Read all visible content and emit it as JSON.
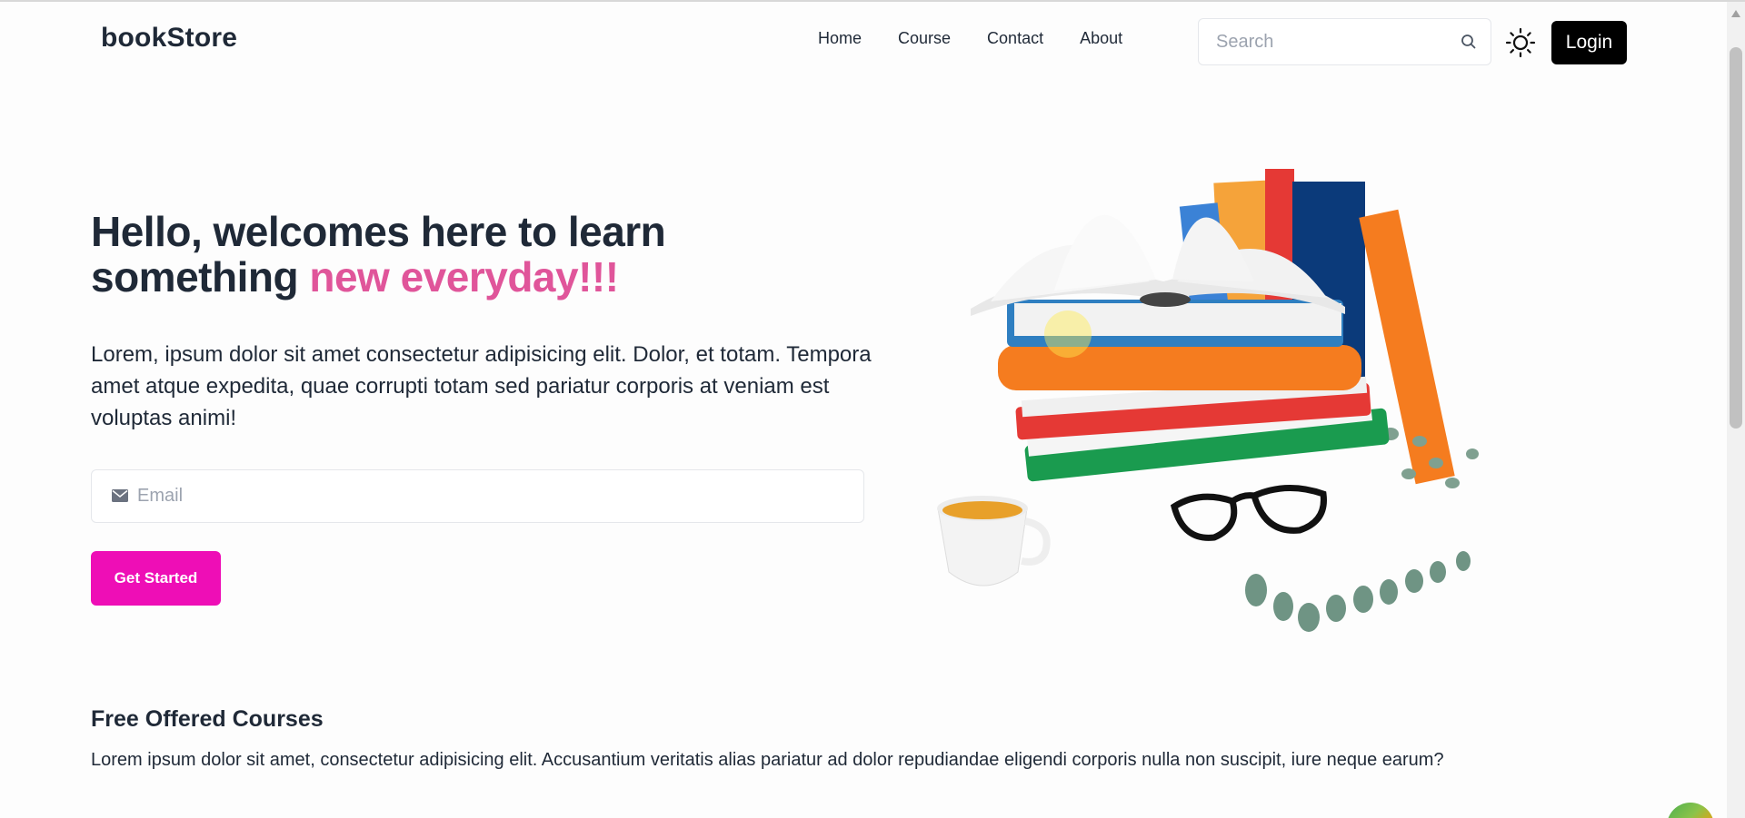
{
  "navbar": {
    "logo": "bookStore",
    "links": [
      "Home",
      "Course",
      "Contact",
      "About"
    ],
    "search_placeholder": "Search",
    "login_label": "Login"
  },
  "hero": {
    "title_part1": "Hello, welcomes here to learn something ",
    "title_accent": "new everyday!!!",
    "description": "Lorem, ipsum dolor sit amet consectetur adipisicing elit. Dolor, et totam. Tempora amet atque expedita, quae corrupti totam sed pariatur corporis at veniam est voluptas animi!",
    "email_placeholder": "Email",
    "cta_label": "Get Started"
  },
  "courses": {
    "title": "Free Offered Courses",
    "description": "Lorem ipsum dolor sit amet, consectetur adipisicing elit. Accusantium veritatis alias pariatur ad dolor repudiandae eligendi corporis nulla non suscipit, iure neque earum?"
  },
  "icons": {
    "search": "search-icon",
    "theme": "sun-icon",
    "email": "mail-icon"
  },
  "colors": {
    "accent_pink": "#e0559a",
    "cta_magenta": "#ee0eb6",
    "login_black": "#000000"
  }
}
